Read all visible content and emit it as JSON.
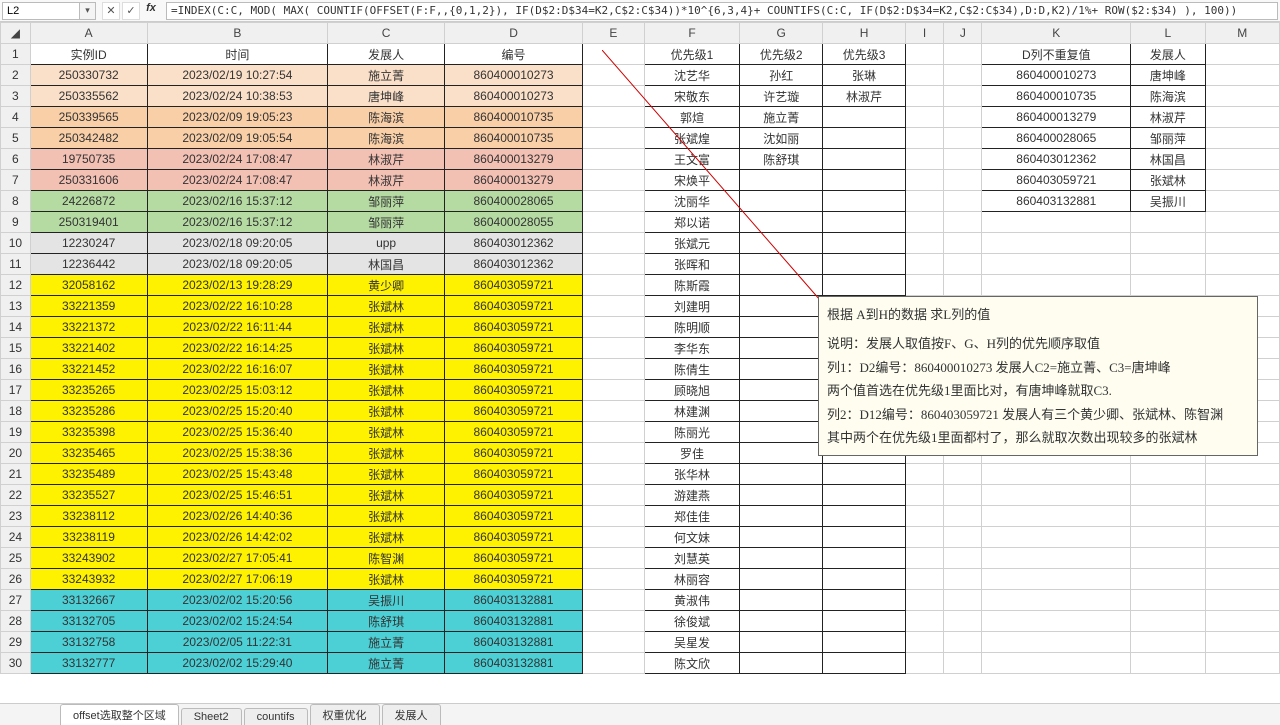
{
  "nameBox": "L2",
  "formula": "=INDEX(C:C, MOD( MAX( COUNTIF(OFFSET(F:F,,{0,1,2}),  IF(D$2:D$34=K2,C$2:C$34))*10^{6,3,4}+ COUNTIFS(C:C, IF(D$2:D$34=K2,C$2:C$34),D:D,K2)/1%+ ROW($2:$34) ), 100))",
  "cols": [
    "A",
    "B",
    "C",
    "D",
    "E",
    "F",
    "G",
    "H",
    "I",
    "J",
    "K",
    "L",
    "M"
  ],
  "headerRow": {
    "A": "实例ID",
    "B": "时间",
    "C": "发展人",
    "D": "编号",
    "F": "优先级1",
    "G": "优先级2",
    "H": "优先级3",
    "K": "D列不重复值",
    "L": "发展人"
  },
  "main": [
    {
      "r": 2,
      "A": "250330732",
      "B": "2023/02/19 10:27:54",
      "C": "施立菁",
      "D": "860400010273",
      "fill": "f-peach"
    },
    {
      "r": 3,
      "A": "250335562",
      "B": "2023/02/24 10:38:53",
      "C": "唐坤峰",
      "D": "860400010273",
      "fill": "f-peach"
    },
    {
      "r": 4,
      "A": "250339565",
      "B": "2023/02/09 19:05:23",
      "C": "陈海滨",
      "D": "860400010735",
      "fill": "f-peach2"
    },
    {
      "r": 5,
      "A": "250342482",
      "B": "2023/02/09 19:05:54",
      "C": "陈海滨",
      "D": "860400010735",
      "fill": "f-peach2"
    },
    {
      "r": 6,
      "A": "19750735",
      "B": "2023/02/24 17:08:47",
      "C": "林淑芹",
      "D": "860400013279",
      "fill": "f-rose"
    },
    {
      "r": 7,
      "A": "250331606",
      "B": "2023/02/24 17:08:47",
      "C": "林淑芹",
      "D": "860400013279",
      "fill": "f-rose"
    },
    {
      "r": 8,
      "A": "24226872",
      "B": "2023/02/16 15:37:12",
      "C": "邹丽萍",
      "D": "860400028065",
      "fill": "f-green"
    },
    {
      "r": 9,
      "A": "250319401",
      "B": "2023/02/16 15:37:12",
      "C": "邹丽萍",
      "D": "860400028055",
      "fill": "f-green"
    },
    {
      "r": 10,
      "A": "12230247",
      "B": "2023/02/18 09:20:05",
      "C": "upp",
      "D": "860403012362",
      "fill": "f-grey"
    },
    {
      "r": 11,
      "A": "12236442",
      "B": "2023/02/18 09:20:05",
      "C": "林国昌",
      "D": "860403012362",
      "fill": "f-grey"
    },
    {
      "r": 12,
      "A": "32058162",
      "B": "2023/02/13 19:28:29",
      "C": "黄少卿",
      "D": "860403059721",
      "fill": "f-yellow"
    },
    {
      "r": 13,
      "A": "33221359",
      "B": "2023/02/22 16:10:28",
      "C": "张斌林",
      "D": "860403059721",
      "fill": "f-yellow"
    },
    {
      "r": 14,
      "A": "33221372",
      "B": "2023/02/22 16:11:44",
      "C": "张斌林",
      "D": "860403059721",
      "fill": "f-yellow"
    },
    {
      "r": 15,
      "A": "33221402",
      "B": "2023/02/22 16:14:25",
      "C": "张斌林",
      "D": "860403059721",
      "fill": "f-yellow"
    },
    {
      "r": 16,
      "A": "33221452",
      "B": "2023/02/22 16:16:07",
      "C": "张斌林",
      "D": "860403059721",
      "fill": "f-yellow"
    },
    {
      "r": 17,
      "A": "33235265",
      "B": "2023/02/25 15:03:12",
      "C": "张斌林",
      "D": "860403059721",
      "fill": "f-yellow"
    },
    {
      "r": 18,
      "A": "33235286",
      "B": "2023/02/25 15:20:40",
      "C": "张斌林",
      "D": "860403059721",
      "fill": "f-yellow"
    },
    {
      "r": 19,
      "A": "33235398",
      "B": "2023/02/25 15:36:40",
      "C": "张斌林",
      "D": "860403059721",
      "fill": "f-yellow"
    },
    {
      "r": 20,
      "A": "33235465",
      "B": "2023/02/25 15:38:36",
      "C": "张斌林",
      "D": "860403059721",
      "fill": "f-yellow"
    },
    {
      "r": 21,
      "A": "33235489",
      "B": "2023/02/25 15:43:48",
      "C": "张斌林",
      "D": "860403059721",
      "fill": "f-yellow"
    },
    {
      "r": 22,
      "A": "33235527",
      "B": "2023/02/25 15:46:51",
      "C": "张斌林",
      "D": "860403059721",
      "fill": "f-yellow"
    },
    {
      "r": 23,
      "A": "33238112",
      "B": "2023/02/26 14:40:36",
      "C": "张斌林",
      "D": "860403059721",
      "fill": "f-yellow"
    },
    {
      "r": 24,
      "A": "33238119",
      "B": "2023/02/26 14:42:02",
      "C": "张斌林",
      "D": "860403059721",
      "fill": "f-yellow"
    },
    {
      "r": 25,
      "A": "33243902",
      "B": "2023/02/27 17:05:41",
      "C": "陈智渊",
      "D": "860403059721",
      "fill": "f-yellow"
    },
    {
      "r": 26,
      "A": "33243932",
      "B": "2023/02/27 17:06:19",
      "C": "张斌林",
      "D": "860403059721",
      "fill": "f-yellow"
    },
    {
      "r": 27,
      "A": "33132667",
      "B": "2023/02/02 15:20:56",
      "C": "吴振川",
      "D": "860403132881",
      "fill": "f-cyan"
    },
    {
      "r": 28,
      "A": "33132705",
      "B": "2023/02/02 15:24:54",
      "C": "陈舒琪",
      "D": "860403132881",
      "fill": "f-cyan"
    },
    {
      "r": 29,
      "A": "33132758",
      "B": "2023/02/05 11:22:31",
      "C": "施立菁",
      "D": "860403132881",
      "fill": "f-cyan"
    },
    {
      "r": 30,
      "A": "33132777",
      "B": "2023/02/02 15:29:40",
      "C": "施立菁",
      "D": "860403132881",
      "fill": "f-cyan"
    }
  ],
  "priority": [
    {
      "r": 2,
      "F": "沈艺华",
      "G": "孙红",
      "H": "张琳"
    },
    {
      "r": 3,
      "F": "宋敬东",
      "G": "许艺璇",
      "H": "林淑芹"
    },
    {
      "r": 4,
      "F": "郭煊",
      "G": "施立菁",
      "H": ""
    },
    {
      "r": 5,
      "F": "张斌煌",
      "G": "沈如丽",
      "H": ""
    },
    {
      "r": 6,
      "F": "王文富",
      "G": "陈舒琪",
      "H": ""
    },
    {
      "r": 7,
      "F": "宋焕平",
      "G": "",
      "H": ""
    },
    {
      "r": 8,
      "F": "沈丽华",
      "G": "",
      "H": ""
    },
    {
      "r": 9,
      "F": "郑以诺",
      "G": "",
      "H": ""
    },
    {
      "r": 10,
      "F": "张斌元",
      "G": "",
      "H": ""
    },
    {
      "r": 11,
      "F": "张晖和",
      "G": "",
      "H": ""
    },
    {
      "r": 12,
      "F": "陈斯霞",
      "G": "",
      "H": ""
    },
    {
      "r": 13,
      "F": "刘建明",
      "G": "",
      "H": ""
    },
    {
      "r": 14,
      "F": "陈明顺",
      "G": "",
      "H": ""
    },
    {
      "r": 15,
      "F": "李华东",
      "G": "",
      "H": ""
    },
    {
      "r": 16,
      "F": "陈倩生",
      "G": "",
      "H": ""
    },
    {
      "r": 17,
      "F": "顾晓旭",
      "G": "",
      "H": ""
    },
    {
      "r": 18,
      "F": "林建渊",
      "G": "",
      "H": ""
    },
    {
      "r": 19,
      "F": "陈丽光",
      "G": "",
      "H": ""
    },
    {
      "r": 20,
      "F": "罗佳",
      "G": "",
      "H": ""
    },
    {
      "r": 21,
      "F": "张华林",
      "G": "",
      "H": ""
    },
    {
      "r": 22,
      "F": "游建燕",
      "G": "",
      "H": ""
    },
    {
      "r": 23,
      "F": "郑佳佳",
      "G": "",
      "H": ""
    },
    {
      "r": 24,
      "F": "何文妹",
      "G": "",
      "H": ""
    },
    {
      "r": 25,
      "F": "刘慧英",
      "G": "",
      "H": ""
    },
    {
      "r": 26,
      "F": "林丽容",
      "G": "",
      "H": ""
    },
    {
      "r": 27,
      "F": "黄淑伟",
      "G": "",
      "H": ""
    },
    {
      "r": 28,
      "F": "徐俊斌",
      "G": "",
      "H": ""
    },
    {
      "r": 29,
      "F": "吴星发",
      "G": "",
      "H": ""
    },
    {
      "r": 30,
      "F": "陈文欣",
      "G": "",
      "H": ""
    }
  ],
  "kl": [
    {
      "r": 2,
      "K": "860400010273",
      "L": "唐坤峰"
    },
    {
      "r": 3,
      "K": "860400010735",
      "L": "陈海滨"
    },
    {
      "r": 4,
      "K": "860400013279",
      "L": "林淑芹"
    },
    {
      "r": 5,
      "K": "860400028065",
      "L": "邹丽萍"
    },
    {
      "r": 6,
      "K": "860403012362",
      "L": "林国昌"
    },
    {
      "r": 7,
      "K": "860403059721",
      "L": "张斌林"
    },
    {
      "r": 8,
      "K": "860403132881",
      "L": "吴振川"
    }
  ],
  "note": [
    "根据 A到H的数据 求L列的值",
    "",
    "说明：发展人取值按F、G、H列的优先顺序取值",
    "列1：D2编号：860400010273  发展人C2=施立菁、C3=唐坤峰",
    "两个值首选在优先级1里面比对，有唐坤峰就取C3.",
    "列2：D12编号：860403059721  发展人有三个黄少卿、张斌林、陈智渊",
    "其中两个在优先级1里面都村了，那么就取次数出现较多的张斌林"
  ],
  "tabs": [
    "offset选取整个区域",
    "Sheet2",
    "countifs",
    "权重优化",
    "发展人"
  ]
}
